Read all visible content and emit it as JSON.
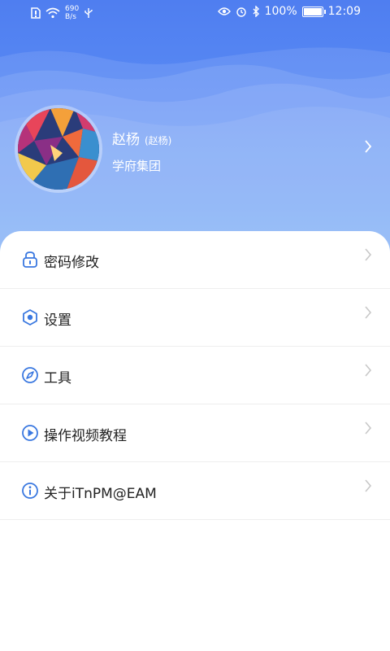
{
  "status_bar": {
    "net_speed_value": "690",
    "net_speed_unit": "B/s",
    "battery": "100%",
    "time": "12:09"
  },
  "profile": {
    "name": "赵杨",
    "alias": "(赵杨)",
    "organization": "学府集团"
  },
  "menu": [
    {
      "label": "密码修改",
      "icon": "lock-icon"
    },
    {
      "label": "设置",
      "icon": "settings-hex-icon"
    },
    {
      "label": "工具",
      "icon": "compass-icon"
    },
    {
      "label": "操作视频教程",
      "icon": "play-icon"
    },
    {
      "label": "关于iTnPM@EAM",
      "icon": "info-icon"
    }
  ],
  "colors": {
    "header_top": "#4f7ef0",
    "header_bottom": "#6aa2f7",
    "icon_accent": "#3a78e0"
  }
}
